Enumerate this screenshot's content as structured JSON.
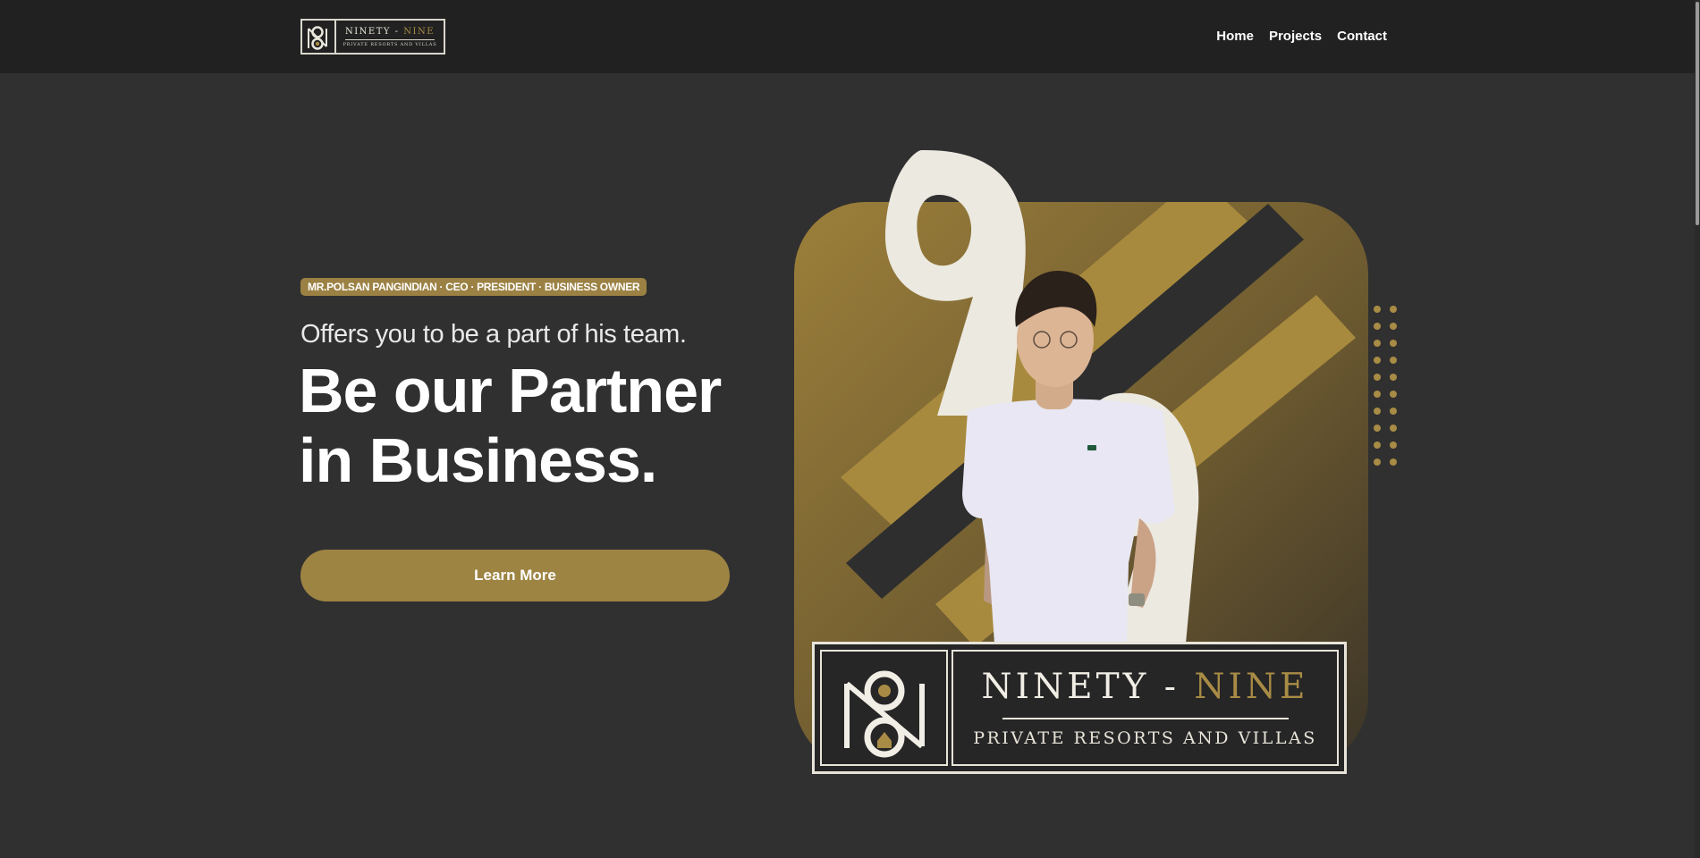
{
  "header": {
    "logo": {
      "brand_left": "NINETY - ",
      "brand_right": "NINE",
      "tagline": "PRIVATE RESORTS AND VILLAS",
      "icon": "ninety-nine-monogram-icon"
    },
    "nav": [
      {
        "label": "Home"
      },
      {
        "label": "Projects"
      },
      {
        "label": "Contact"
      }
    ]
  },
  "hero": {
    "badge": "MR.POLSAN PANGINDIAN · CEO · PRESIDENT · BUSINESS OWNER",
    "offer": "Offers you to be a part of his team.",
    "headline_line1": "Be our Partner",
    "headline_line2": "in Business.",
    "cta": "Learn More",
    "feature_logo": {
      "brand_left": "NINETY - ",
      "brand_right": "NINE",
      "tagline": "PRIVATE RESORTS AND VILLAS"
    }
  },
  "colors": {
    "background": "#303030",
    "header": "#212121",
    "gold": "#9e8443",
    "cream": "#e8e4da"
  }
}
